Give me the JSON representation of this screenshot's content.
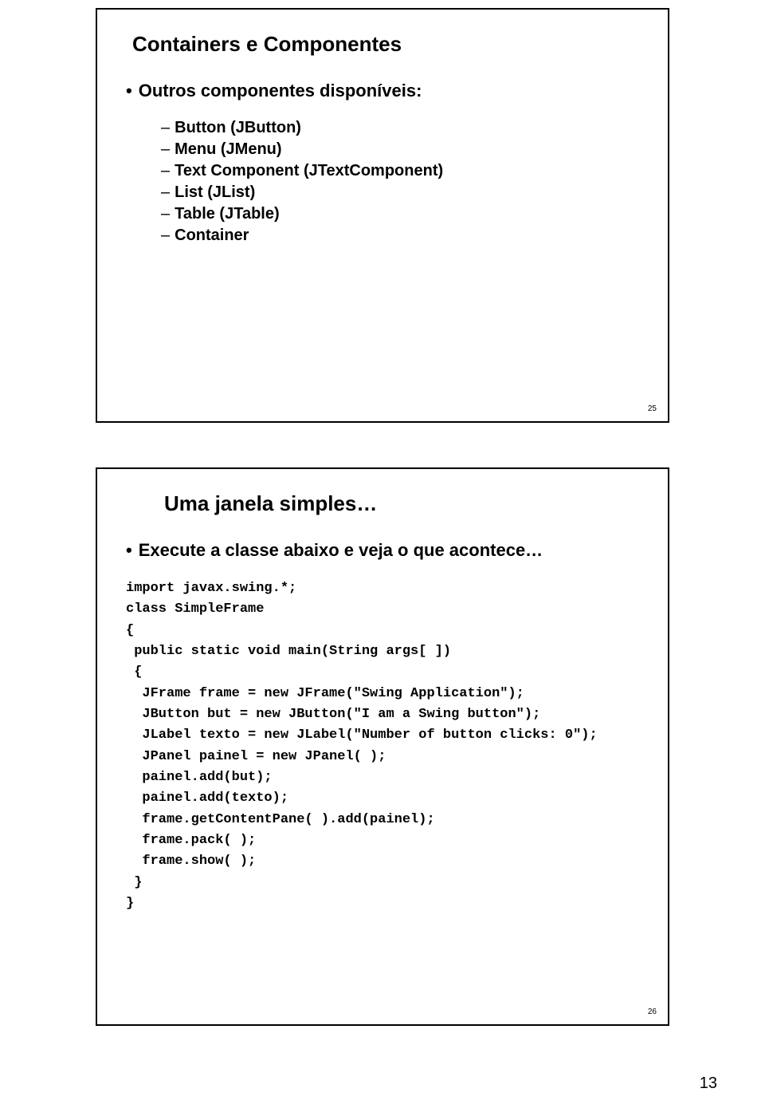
{
  "slide1": {
    "title": "Containers e Componentes",
    "bullet": "Outros componentes disponíveis:",
    "items": [
      "Button (JButton)",
      "Menu (JMenu)",
      "Text Component (JTextComponent)",
      "List (JList)",
      "Table (JTable)",
      "Container"
    ],
    "num": "25"
  },
  "slide2": {
    "title": "Uma janela simples…",
    "bullet": "Execute a classe abaixo e veja o que acontece…",
    "code": "import javax.swing.*;\nclass SimpleFrame\n{\n public static void main(String args[ ])\n {\n  JFrame frame = new JFrame(\"Swing Application\");\n  JButton but = new JButton(\"I am a Swing button\");\n  JLabel texto = new JLabel(\"Number of button clicks: 0\");\n  JPanel painel = new JPanel( );\n  painel.add(but);\n  painel.add(texto);\n  frame.getContentPane( ).add(painel);\n  frame.pack( );\n  frame.show( );\n }\n}",
    "num": "26"
  },
  "pageNumber": "13"
}
